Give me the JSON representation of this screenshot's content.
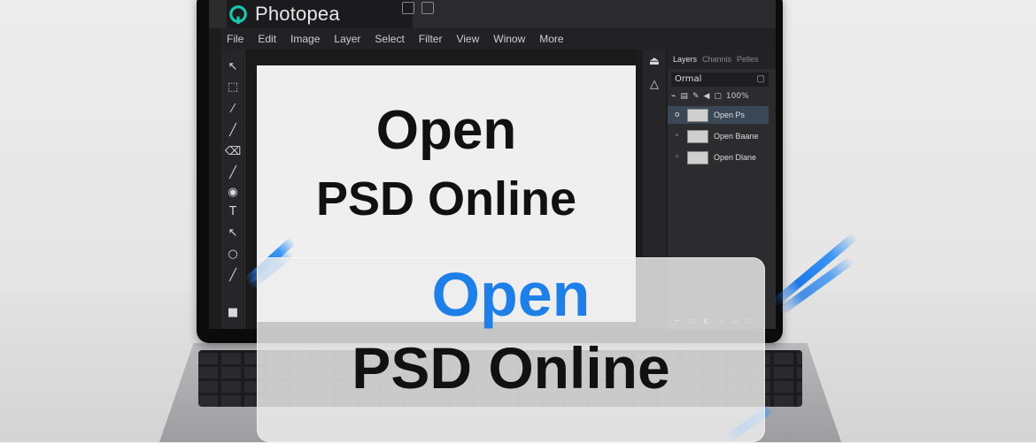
{
  "app": {
    "brand_name": "Photopea",
    "menu": [
      "File",
      "Edit",
      "Image",
      "Layer",
      "Select",
      "Filter",
      "View",
      "Winow",
      "More"
    ]
  },
  "toolbar": {
    "tools": [
      {
        "icon": "move-icon",
        "glyph": "↖"
      },
      {
        "icon": "marquee-icon",
        "glyph": "⬚"
      },
      {
        "icon": "magic-wand-icon",
        "glyph": "⁄"
      },
      {
        "icon": "brush-icon",
        "glyph": "╱"
      },
      {
        "icon": "eraser-icon",
        "glyph": "⌫"
      },
      {
        "icon": "pencil-icon",
        "glyph": "╱"
      },
      {
        "icon": "blur-icon",
        "glyph": "◉"
      },
      {
        "icon": "type-icon",
        "glyph": "T"
      },
      {
        "icon": "path-select-icon",
        "glyph": "↖"
      },
      {
        "icon": "ellipse-icon",
        "glyph": "○"
      },
      {
        "icon": "hand-icon",
        "glyph": "╱"
      },
      {
        "icon": "color-swatch-icon",
        "glyph": "■"
      }
    ]
  },
  "canvas": {
    "line1": "Open",
    "line2": "PSD Online"
  },
  "panel": {
    "tabs": [
      "Layers",
      "Channis",
      "Pelles"
    ],
    "blend_mode": "Ormal",
    "opacity": "100%",
    "layers": [
      {
        "name": "Open Ps",
        "selected": true
      },
      {
        "name": "Open Baane",
        "selected": false
      },
      {
        "name": "Open Dlane",
        "selected": false
      }
    ]
  },
  "overlay": {
    "line1": "Open",
    "line2": "PSD Online"
  },
  "colors": {
    "accent_blue": "#1f7fe8",
    "selected_layer": "#3a4756"
  }
}
